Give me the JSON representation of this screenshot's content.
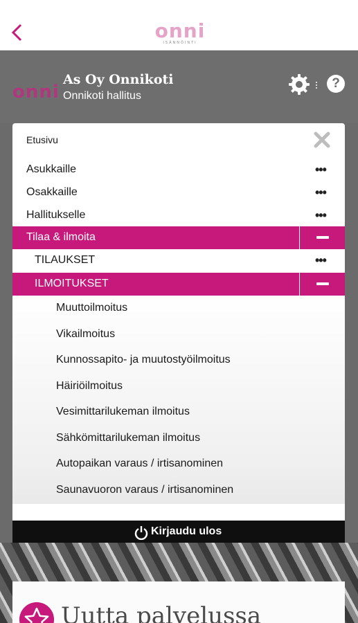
{
  "topbar": {
    "logo_text": "onni",
    "logo_sub": "ISÄNNÖINTI"
  },
  "header": {
    "logo_text": "onni",
    "title": "As Oy Onnikoti",
    "subtitle": "Onnikoti hallitus",
    "help_label": "?"
  },
  "menu": {
    "home_label": "Etusivu",
    "items": [
      {
        "label": "Asukkaille",
        "more": "•••"
      },
      {
        "label": "Osakkaille",
        "more": "•••"
      },
      {
        "label": "Hallitukselle",
        "more": "•••"
      },
      {
        "label": "Tilaa & ilmoita"
      },
      {
        "label": "TILAUKSET",
        "more": "•••"
      },
      {
        "label": "ILMOITUKSET"
      }
    ],
    "subitems": [
      "Muuttoilmoitus",
      "Vikailmoitus",
      "Kunnossapito- ja muutostyöilmoitus",
      "Häiriöilmoitus",
      "Vesimittarilukeman ilmoitus",
      "Sähkömittarilukeman ilmoitus",
      "Autopaikan varaus / irtisanominen",
      "Saunavuoron varaus / irtisanominen"
    ]
  },
  "logout": {
    "label": "Kirjaudu ulos"
  },
  "card": {
    "title": "Uutta palvelussa"
  },
  "colors": {
    "accent": "#c7197c",
    "logo_pink": "#e6a3c8",
    "header_bg": "#6e6e6e"
  }
}
